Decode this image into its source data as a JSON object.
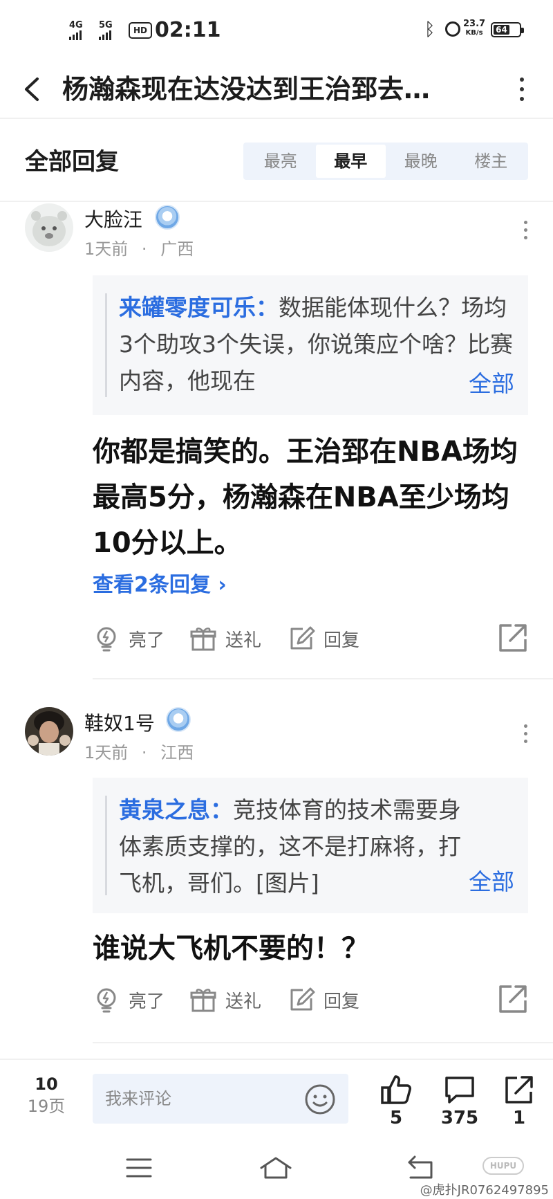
{
  "status_bar": {
    "net1": "4G",
    "net2": "5G",
    "hd": "HD",
    "time": "02:11",
    "speed_value": "23.7",
    "speed_unit": "KB/s",
    "battery": "64"
  },
  "header": {
    "title": "杨瀚森现在达没达到王治郅去…"
  },
  "section": {
    "title": "全部回复",
    "sort_tabs": [
      {
        "label": "最亮",
        "active": false
      },
      {
        "label": "最早",
        "active": true
      },
      {
        "label": "最晚",
        "active": false
      },
      {
        "label": "楼主",
        "active": false
      }
    ]
  },
  "comments": [
    {
      "username": "大脸汪",
      "time": "1天前",
      "location": "广西",
      "quote_author": "来罐零度可乐：",
      "quote_text": "数据能体现什么？场均3个助攻3个失误，你说策应个啥？比赛内容，他现在",
      "quote_more": "全部",
      "content": "你都是搞笑的。王治郅在NBA场均最高5分，杨瀚森在NBA至少场均10分以上。",
      "view_replies": "查看2条回复 ›",
      "actions": {
        "light": "亮了",
        "gift": "送礼",
        "reply": "回复"
      }
    },
    {
      "username": "鞋奴1号",
      "time": "1天前",
      "location": "江西",
      "quote_author": "黄泉之息：",
      "quote_text": "竞技体育的技术需要身体素质支撑的，这不是打麻将，打飞机，哥们。[图片]",
      "quote_more": "全部",
      "content": "谁说大飞机不要的！？",
      "actions": {
        "light": "亮了",
        "gift": "送礼",
        "reply": "回复"
      }
    }
  ],
  "meta_separator": "·",
  "bottom_bar": {
    "page_current": "10",
    "page_total": "19页",
    "comment_placeholder": "我来评论",
    "like_count": "5",
    "comment_count": "375",
    "share_count": "1"
  },
  "watermark": {
    "text": "@虎扑JR0762497895",
    "logo": "HUPU"
  }
}
